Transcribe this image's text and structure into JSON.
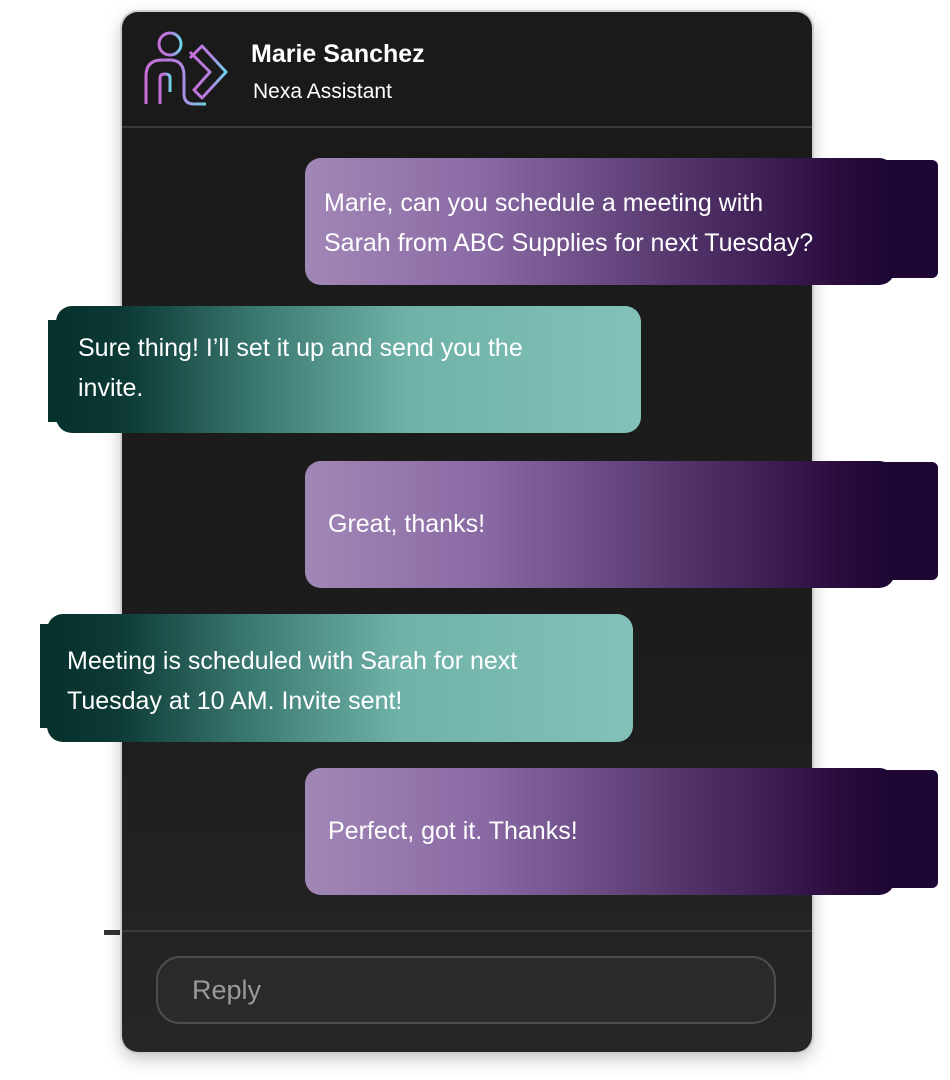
{
  "header": {
    "name": "Marie Sanchez",
    "subtitle": "Nexa Assistant",
    "logo_icon": "nexa-logo-icon"
  },
  "messages": [
    {
      "direction": "outgoing",
      "lines": [
        "Marie, can you schedule a meeting with",
        "Sarah from ABC Supplies for next Tuesday?"
      ]
    },
    {
      "direction": "incoming",
      "lines": [
        "Sure thing! I’ll set it up and send you the",
        "invite."
      ]
    },
    {
      "direction": "outgoing",
      "lines": [
        "Great, thanks!"
      ]
    },
    {
      "direction": "incoming",
      "lines": [
        "Meeting is scheduled with Sarah for next",
        "Tuesday at 10 AM. Invite sent!"
      ]
    },
    {
      "direction": "outgoing",
      "lines": [
        "Perfect, got it. Thanks!"
      ]
    }
  ],
  "reply": {
    "placeholder": "Reply"
  },
  "colors": {
    "window_bg": "#1a1a1a",
    "outgoing_start": "#a187b6",
    "outgoing_end": "#1c0630",
    "incoming_start": "#06302c",
    "incoming_end": "#83c1b8",
    "text": "#ffffff",
    "placeholder": "#9a9a9a"
  }
}
